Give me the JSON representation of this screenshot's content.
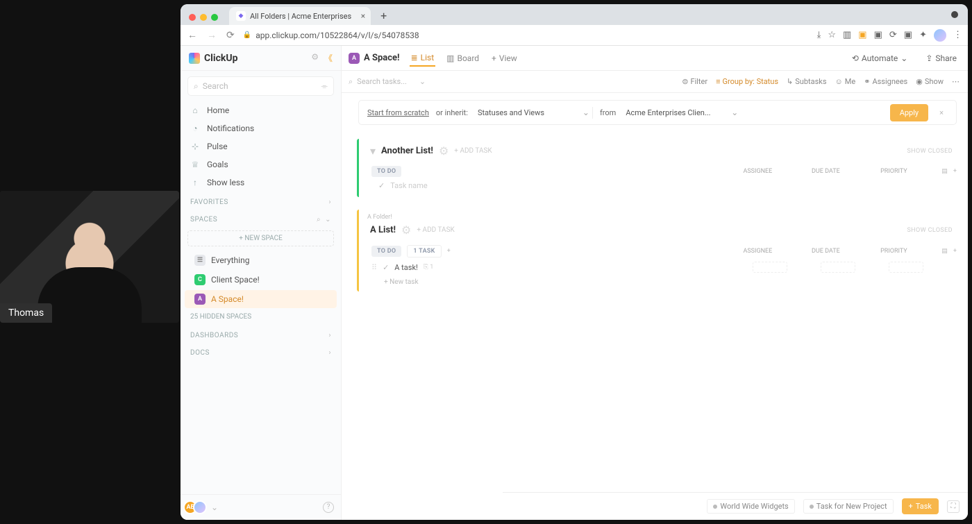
{
  "presenter": {
    "name": "Thomas"
  },
  "browser": {
    "tab_title": "All Folders | Acme Enterprises",
    "url": "app.clickup.com/10522864/v/l/s/54078538"
  },
  "brand": "ClickUp",
  "sidebar": {
    "search_placeholder": "Search",
    "nav": {
      "home": "Home",
      "notifications": "Notifications",
      "pulse": "Pulse",
      "goals": "Goals",
      "showless": "Show less"
    },
    "favorites_label": "FAVORITES",
    "spaces_label": "SPACES",
    "new_space": "+ NEW SPACE",
    "everything": "Everything",
    "space1": "Client Space!",
    "space2": "A Space!",
    "hidden": "25 HIDDEN SPACES",
    "dashboards": "DASHBOARDS",
    "docs": "DOCS"
  },
  "header": {
    "space_name": "A Space!",
    "view_list": "List",
    "view_board": "Board",
    "add_view": "View",
    "automate": "Automate",
    "share": "Share"
  },
  "toolbar": {
    "search_placeholder": "Search tasks...",
    "filter": "Filter",
    "groupby": "Group by: Status",
    "subtasks": "Subtasks",
    "me": "Me",
    "assignees": "Assignees",
    "show": "Show"
  },
  "inherit": {
    "start": "Start from scratch",
    "or": " or inherit:",
    "select1": "Statuses and Views",
    "from": "from",
    "select2": "Acme Enterprises Clien...",
    "apply": "Apply"
  },
  "lists": [
    {
      "title": "Another List!",
      "add_task_ghost": "+ ADD TASK",
      "closed_label": "SHOW CLOSED",
      "status": "TO DO",
      "task_count": "",
      "cols": {
        "assignee": "ASSIGNEE",
        "due": "DUE DATE",
        "priority": "PRIORITY"
      },
      "placeholder_row": "Task name"
    },
    {
      "folder": "A Folder!",
      "title": "A List!",
      "add_task_ghost": "+ ADD TASK",
      "closed_label": "SHOW CLOSED",
      "status": "TO DO",
      "task_count": "1 TASK",
      "cols": {
        "assignee": "ASSIGNEE",
        "due": "DUE DATE",
        "priority": "PRIORITY"
      },
      "task1": "A task!",
      "new_task": "+ New task"
    }
  ],
  "footer": {
    "chip1": "World Wide Widgets",
    "chip2": "Task for New Project",
    "task_btn": "Task"
  }
}
